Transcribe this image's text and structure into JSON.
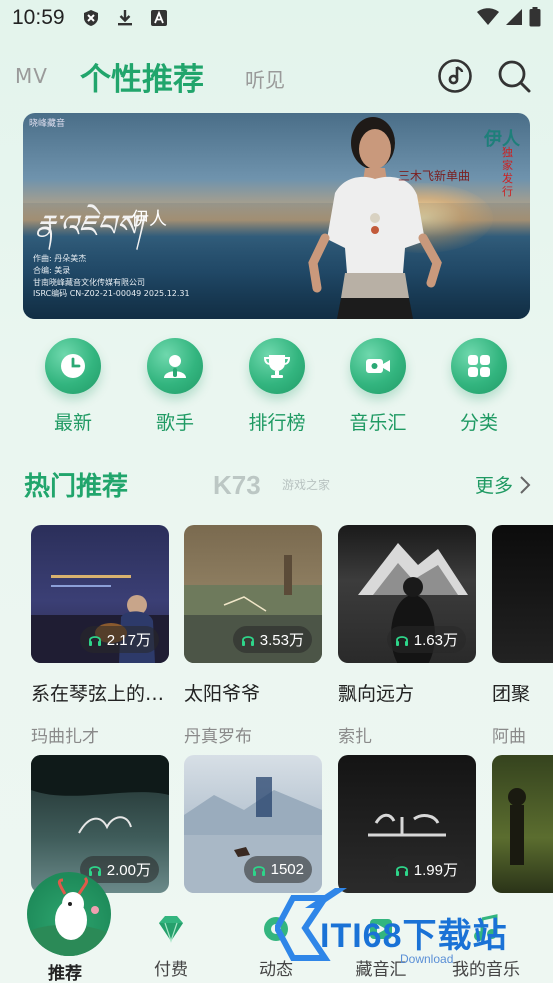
{
  "status_bar": {
    "time": "10:59"
  },
  "header": {
    "tabs": [
      {
        "label": "MV"
      },
      {
        "label": "个性推荐"
      },
      {
        "label": "听见"
      }
    ]
  },
  "banner": {
    "brand": "晓峰藏音",
    "title_left": "伊人",
    "title_right": "伊人",
    "subtitle_right": "独家发行",
    "tag": "三木飞新单曲",
    "tibetan_title": "རྣ་འཇེབས།",
    "credits": [
      "作曲: 丹朵美杰",
      "合编: 美录",
      "甘南晓峰藏音文化传媒有限公司",
      "ISRC编码 CN-Z02-21-00049 2025.12.31"
    ]
  },
  "quick_menu": [
    {
      "label": "最新",
      "icon": "clock-icon"
    },
    {
      "label": "歌手",
      "icon": "singer-icon"
    },
    {
      "label": "排行榜",
      "icon": "trophy-icon"
    },
    {
      "label": "音乐汇",
      "icon": "video-icon"
    },
    {
      "label": "分类",
      "icon": "grid-icon"
    }
  ],
  "hot_section": {
    "title": "热门推荐",
    "more": "更多",
    "watermark": "K73",
    "watermark_sub": "游戏之家"
  },
  "cards_row1": [
    {
      "title": "系在琴弦上的…",
      "artist": "玛曲扎才",
      "plays": "2.17万"
    },
    {
      "title": "太阳爷爷",
      "artist": "丹真罗布",
      "plays": "3.53万"
    },
    {
      "title": "飘向远方",
      "artist": "索扎",
      "plays": "1.63万"
    },
    {
      "title": "团聚",
      "artist": "阿曲",
      "plays": ""
    }
  ],
  "cards_row2": [
    {
      "title": "",
      "artist": "",
      "plays": "2.00万"
    },
    {
      "title": "",
      "artist": "",
      "plays": "1502"
    },
    {
      "title": "",
      "artist": "",
      "plays": "1.99万"
    },
    {
      "title": "",
      "artist": "",
      "plays": ""
    }
  ],
  "bottom_nav": [
    {
      "label": "推荐",
      "icon": "recommend-icon"
    },
    {
      "label": "付费",
      "icon": "diamond-icon"
    },
    {
      "label": "动态",
      "icon": "moments-icon"
    },
    {
      "label": "藏音汇",
      "icon": "collection-icon"
    },
    {
      "label": "我的音乐",
      "icon": "my-music-icon"
    }
  ],
  "watermark_bottom": {
    "text": "ITI68下载站",
    "sub": "Download"
  },
  "colors": {
    "accent": "#21a56c",
    "accent_light": "#33b57f",
    "background": "#e6f5ee"
  }
}
